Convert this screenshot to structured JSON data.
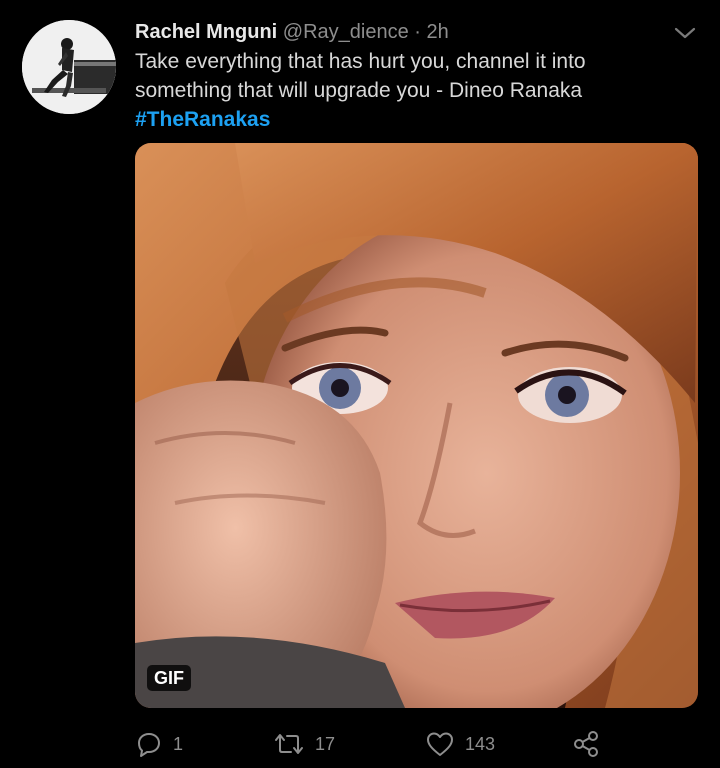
{
  "tweet": {
    "display_name": "Rachel Mnguni",
    "handle": "@Ray_dience",
    "separator": " · ",
    "time": "2h",
    "text": "Take everything that has hurt you, channel it into something that will upgrade you - Dineo Ranaka",
    "hashtag": "#TheRanakas",
    "media": {
      "badge": "GIF"
    },
    "actions": {
      "reply_count": "1",
      "retweet_count": "17",
      "like_count": "143"
    },
    "icons": {
      "menu": "chevron-down-icon",
      "reply": "reply-icon",
      "retweet": "retweet-icon",
      "like": "heart-icon",
      "share": "share-icon"
    }
  },
  "colors": {
    "background": "#000000",
    "link": "#1da1f2",
    "muted": "#8e8e8e",
    "text": "#d8d8d8"
  }
}
